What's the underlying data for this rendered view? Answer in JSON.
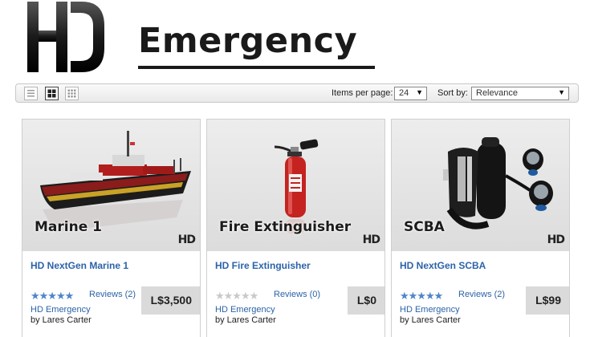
{
  "brand": {
    "logo_mark": "HD",
    "logo_text": "Emergency"
  },
  "toolbar": {
    "views": [
      {
        "name": "list-view",
        "icon": "list-view-icon"
      },
      {
        "name": "grid-view",
        "icon": "grid-view-icon",
        "selected": true
      },
      {
        "name": "small-grid-view",
        "icon": "small-grid-view-icon"
      }
    ],
    "items_per_page_label": "Items per page:",
    "items_per_page_value": "24",
    "sort_label": "Sort by:",
    "sort_value": "Relevance"
  },
  "products": [
    {
      "image_caption": "Marine 1",
      "image_brand": "HD",
      "title": "HD NextGen Marine 1",
      "stars_full": "★★★★★",
      "stars_empty": "",
      "reviews": "Reviews (2)",
      "merchant": "HD Emergency",
      "author": "by Lares Carter",
      "price": "L$3,500"
    },
    {
      "image_caption": "Fire Extinguisher",
      "image_brand": "HD",
      "title": "HD Fire Extinguisher",
      "stars_full": "",
      "stars_empty": "★★★★★",
      "reviews": "Reviews (0)",
      "merchant": "HD Emergency",
      "author": "by Lares Carter",
      "price": "L$0"
    },
    {
      "image_caption": "SCBA",
      "image_brand": "HD",
      "title": "HD NextGen SCBA",
      "stars_full": "★★★★★",
      "stars_empty": "",
      "reviews": "Reviews (2)",
      "merchant": "HD Emergency",
      "author": "by Lares Carter",
      "price": "L$99"
    }
  ],
  "colors": {
    "link": "#2c63a8",
    "star": "#4f86c8",
    "price_bg": "#dadada"
  }
}
